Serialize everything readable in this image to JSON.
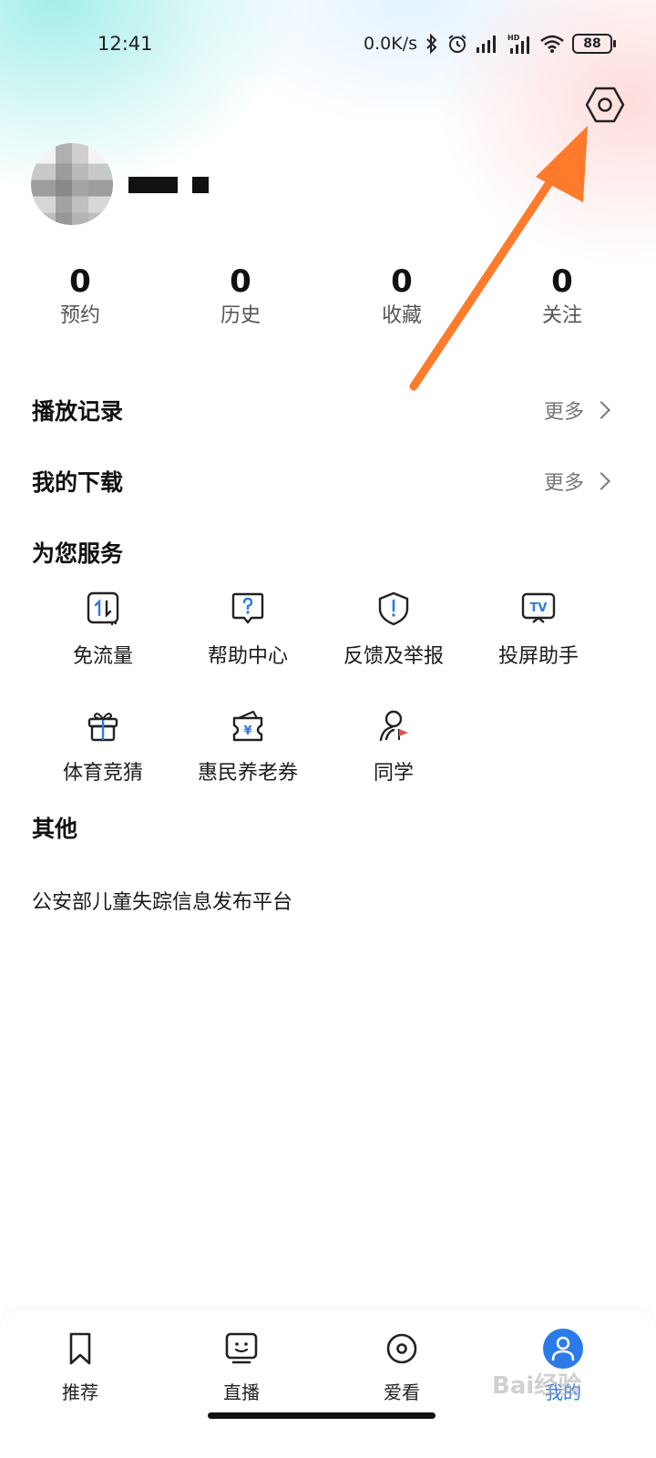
{
  "status_bar": {
    "time": "12:41",
    "net_speed": "0.0K/s",
    "battery": "88",
    "icons": [
      "bluetooth-icon",
      "alarm-icon",
      "signal-icon",
      "hd-signal-icon",
      "wifi-icon",
      "battery-icon"
    ]
  },
  "header": {
    "settings_icon": "settings-hexagon-icon"
  },
  "stats": [
    {
      "value": "0",
      "label": "预约"
    },
    {
      "value": "0",
      "label": "历史"
    },
    {
      "value": "0",
      "label": "收藏"
    },
    {
      "value": "0",
      "label": "关注"
    }
  ],
  "rows": {
    "history_title": "播放记录",
    "history_more": "更多",
    "download_title": "我的下载",
    "download_more": "更多"
  },
  "services": {
    "title": "为您服务",
    "items": [
      {
        "label": "免流量",
        "icon": "data-free-icon"
      },
      {
        "label": "帮助中心",
        "icon": "help-icon"
      },
      {
        "label": "反馈及举报",
        "icon": "report-shield-icon"
      },
      {
        "label": "投屏助手",
        "icon": "tv-cast-icon"
      },
      {
        "label": "体育竞猜",
        "icon": "gift-icon"
      },
      {
        "label": "惠民养老券",
        "icon": "coupon-wallet-icon"
      },
      {
        "label": "同学",
        "icon": "classmate-icon"
      }
    ]
  },
  "other": {
    "title": "其他",
    "link": "公安部儿童失踪信息发布平台"
  },
  "tabs": [
    {
      "label": "推荐",
      "icon": "bookmark-icon"
    },
    {
      "label": "直播",
      "icon": "tv-face-icon"
    },
    {
      "label": "爱看",
      "icon": "disc-icon"
    },
    {
      "label": "我的",
      "icon": "profile-icon",
      "active": true
    }
  ],
  "colors": {
    "accent": "#2b7ae9",
    "annotation_arrow": "#ff7a2a",
    "icon_red": "#e8504f"
  },
  "watermark": "Bai经验"
}
